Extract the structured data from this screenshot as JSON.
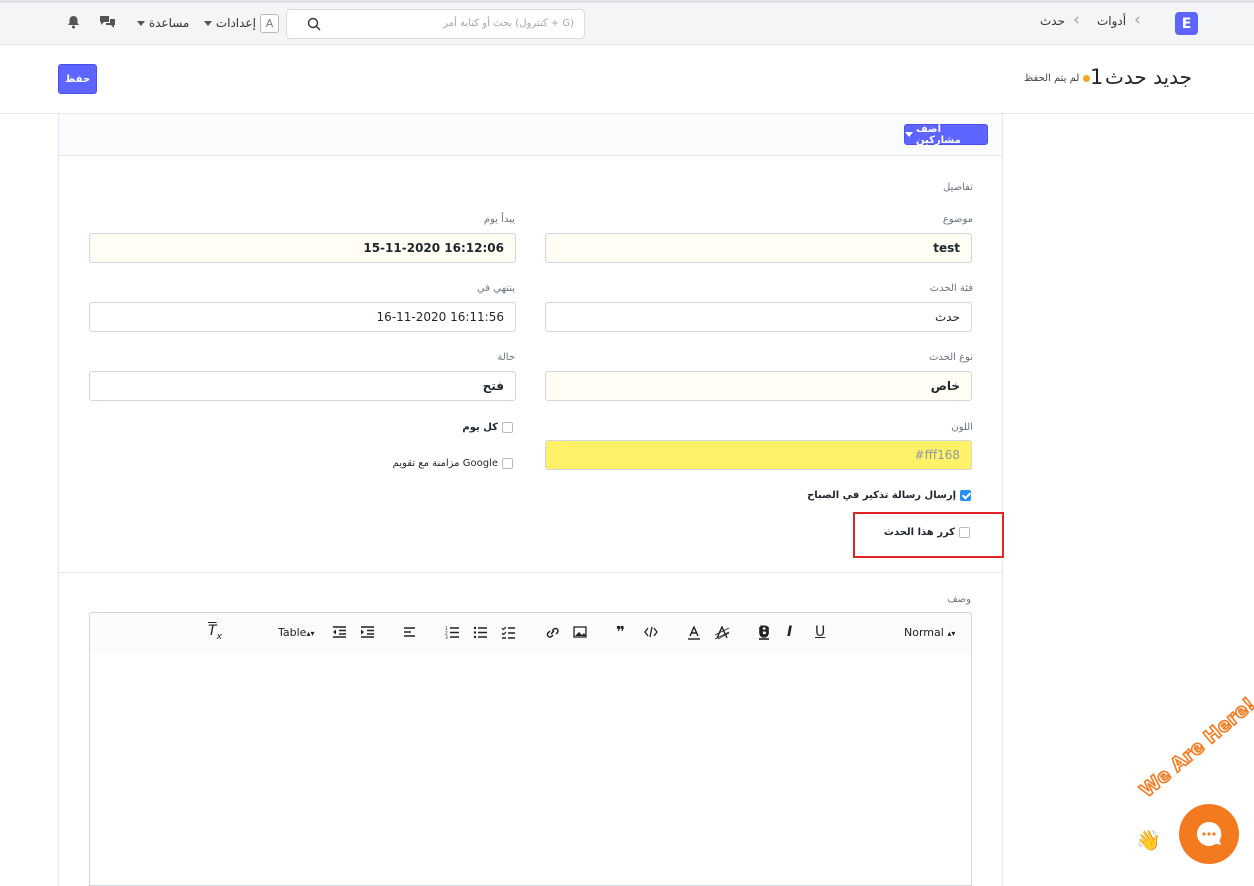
{
  "navbar": {
    "brand_letter": "E",
    "breadcrumbs": [
      "أدوات",
      "حدث"
    ],
    "search_placeholder": "بحث أو كتابة أمر (كنترول + G)",
    "user_initial": "A",
    "settings_label": "إعدادات",
    "help_label": "مساعدة"
  },
  "page": {
    "title": "جديد حدث",
    "title_number": "1",
    "status": "لم يتم الحفظ",
    "save_label": "حفظ"
  },
  "form": {
    "add_participants_label": "أضف مشاركين",
    "section_details": "تفاصيل",
    "subject_label": "موضوع",
    "subject_value": "test",
    "starts_on_label": "يبدأ يوم",
    "starts_on_value": "15-11-2020 16:12:06",
    "category_label": "فئة الحدث",
    "category_value": "حدث",
    "ends_on_label": "ينتهي في",
    "ends_on_value": "16-11-2020 16:11:56",
    "event_type_label": "نوع الحدث",
    "event_type_value": "خاص",
    "status_label": "حالة",
    "status_value": "فتح",
    "color_label": "اللون",
    "color_value": "#fff168",
    "all_day_label": "كل يوم",
    "all_day_checked": false,
    "google_sync_label": "مزامنة مع تقويم Google",
    "google_sync_checked": false,
    "morning_reminder_label": "إرسال رسالة تذكير في الصباح",
    "morning_reminder_checked": true,
    "repeat_label": "كرر هذا الحدث",
    "repeat_checked": false,
    "description_label": "وصف"
  },
  "editor": {
    "format_select": "Normal",
    "table_label": "Table",
    "icons": [
      "underline-icon",
      "italic-icon",
      "bold-icon",
      "background-color-icon",
      "text-color-icon",
      "code-icon",
      "blockquote-icon",
      "image-icon",
      "link-icon",
      "checklist-icon",
      "bullet-list-icon",
      "ordered-list-icon",
      "align-icon",
      "indent-icon",
      "outdent-icon",
      "table-icon",
      "clear-format-icon"
    ]
  },
  "chat": {
    "tagline": "We Are Here!",
    "accent": "#f47a20"
  },
  "colors": {
    "primary": "#5e64ff",
    "highlight_box": "#e02424",
    "unsaved_dot": "#f8a520"
  }
}
